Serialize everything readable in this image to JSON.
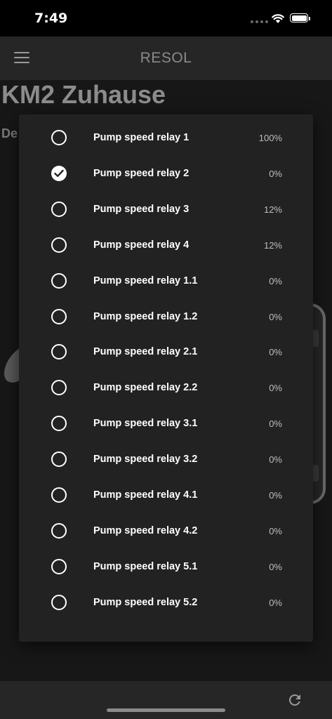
{
  "status_bar": {
    "time": "7:49"
  },
  "app_bar": {
    "title": "RESOL",
    "menu_icon": "hamburger-menu-icon"
  },
  "page": {
    "title": "KM2 Zuhause",
    "subtitle_partial": "De"
  },
  "dialog": {
    "items": [
      {
        "label": "Pump speed relay 1",
        "value": "100%",
        "selected": false
      },
      {
        "label": "Pump speed relay 2",
        "value": "0%",
        "selected": true
      },
      {
        "label": "Pump speed relay 3",
        "value": "12%",
        "selected": false
      },
      {
        "label": "Pump speed relay 4",
        "value": "12%",
        "selected": false
      },
      {
        "label": "Pump speed relay 1.1",
        "value": "0%",
        "selected": false
      },
      {
        "label": "Pump speed relay 1.2",
        "value": "0%",
        "selected": false
      },
      {
        "label": "Pump speed relay 2.1",
        "value": "0%",
        "selected": false
      },
      {
        "label": "Pump speed relay 2.2",
        "value": "0%",
        "selected": false
      },
      {
        "label": "Pump speed relay 3.1",
        "value": "0%",
        "selected": false
      },
      {
        "label": "Pump speed relay 3.2",
        "value": "0%",
        "selected": false
      },
      {
        "label": "Pump speed relay 4.1",
        "value": "0%",
        "selected": false
      },
      {
        "label": "Pump speed relay 4.2",
        "value": "0%",
        "selected": false
      },
      {
        "label": "Pump speed relay 5.1",
        "value": "0%",
        "selected": false
      },
      {
        "label": "Pump speed relay 5.2",
        "value": "0%",
        "selected": false
      }
    ]
  },
  "bottom_bar": {
    "refresh_icon": "refresh-icon"
  },
  "colors": {
    "background": "#171717",
    "dialog": "#222222",
    "appbar": "#262626",
    "text": "#ffffff"
  }
}
